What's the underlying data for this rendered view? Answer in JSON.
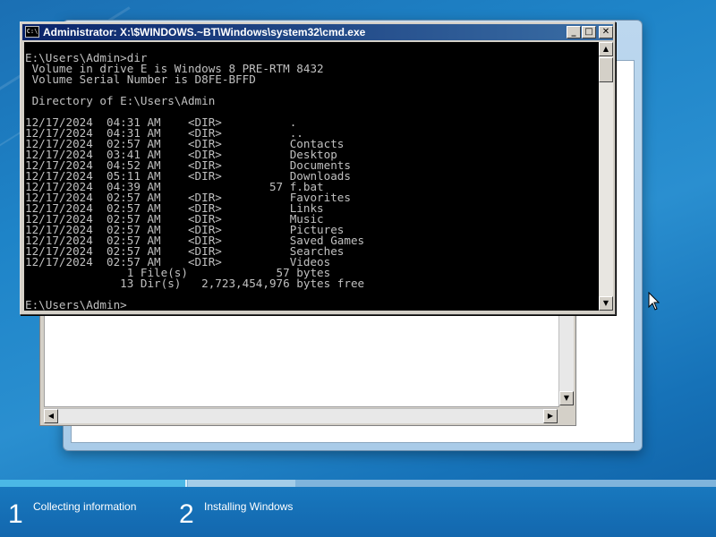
{
  "cmd": {
    "title": "Administrator: X:\\$WINDOWS.~BT\\Windows\\system32\\cmd.exe",
    "icon": "cmd-icon",
    "icon_text": "C:\\",
    "buttons": {
      "minimize": "_",
      "maximize": "□",
      "close": "✕"
    },
    "output": "E:\\Users\\Admin>dir\n Volume in drive E is Windows 8 PRE-RTM 8432\n Volume Serial Number is D8FE-BFFD\n\n Directory of E:\\Users\\Admin\n\n12/17/2024  04:31 AM    <DIR>          .\n12/17/2024  04:31 AM    <DIR>          ..\n12/17/2024  02:57 AM    <DIR>          Contacts\n12/17/2024  03:41 AM    <DIR>          Desktop\n12/17/2024  04:52 AM    <DIR>          Documents\n12/17/2024  05:11 AM    <DIR>          Downloads\n12/17/2024  04:39 AM                57 f.bat\n12/17/2024  02:57 AM    <DIR>          Favorites\n12/17/2024  02:57 AM    <DIR>          Links\n12/17/2024  02:57 AM    <DIR>          Music\n12/17/2024  02:57 AM    <DIR>          Pictures\n12/17/2024  02:57 AM    <DIR>          Saved Games\n12/17/2024  02:57 AM    <DIR>          Searches\n12/17/2024  02:57 AM    <DIR>          Videos\n               1 File(s)             57 bytes\n              13 Dir(s)   2,723,454,976 bytes free\n\nE:\\Users\\Admin>"
  },
  "scroll_arrows": {
    "up": "▲",
    "down": "▼",
    "left": "◀",
    "right": "▶"
  },
  "setup": {
    "steps": [
      {
        "number": "1",
        "label": "Collecting information"
      },
      {
        "number": "2",
        "label": "Installing Windows"
      }
    ],
    "progress_step1": 1.0
  },
  "colors": {
    "desktop": "#1e84c8",
    "console_bg": "#000000",
    "console_fg": "#c0c0c0",
    "titlebar": "#0a246a"
  }
}
